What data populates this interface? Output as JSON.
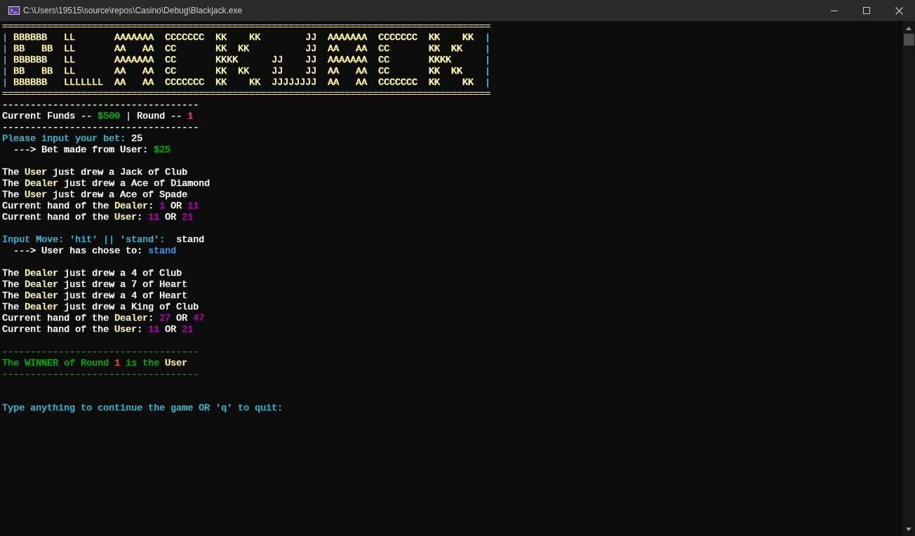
{
  "window": {
    "title": "C:\\Users\\19515\\source\\repos\\Casino\\Debug\\Blackjack.exe"
  },
  "console": {
    "banner": {
      "top_rule": {
        "text": "=======================================================================================",
        "color": "#f9f1a5"
      },
      "lines": [
        {
          "segments": [
            {
              "text": "|",
              "color": "#3ab0c8"
            },
            {
              "text": " BBBBBB   LL       AAAAAAA  CCCCCCC  KK    KK        JJ  AAAAAAA  CCCCCCC  KK    KK  ",
              "color": "#f9f1a5"
            },
            {
              "text": "|",
              "color": "#3ab0c8"
            }
          ]
        },
        {
          "segments": [
            {
              "text": "|",
              "color": "#3ab0c8"
            },
            {
              "text": " BB   BB  LL       AA   AA  CC       KK  KK          JJ  AA   AA  CC       KK  KK    ",
              "color": "#f9f1a5"
            },
            {
              "text": "|",
              "color": "#3ab0c8"
            }
          ]
        },
        {
          "segments": [
            {
              "text": "|",
              "color": "#3ab0c8"
            },
            {
              "text": " BBBBBB   LL       AAAAAAA  CC       KKKK      JJ    JJ  AAAAAAA  CC       KKKK      ",
              "color": "#f9f1a5"
            },
            {
              "text": "|",
              "color": "#3ab0c8"
            }
          ]
        },
        {
          "segments": [
            {
              "text": "|",
              "color": "#3ab0c8"
            },
            {
              "text": " BB   BB  LL       AA   AA  CC       KK  KK    JJ    JJ  AA   AA  CC       KK  KK    ",
              "color": "#f9f1a5"
            },
            {
              "text": "|",
              "color": "#3ab0c8"
            }
          ]
        },
        {
          "segments": [
            {
              "text": "|",
              "color": "#3ab0c8"
            },
            {
              "text": " BBBBBB   LLLLLLL  AA   AA  CCCCCCC  KK    KK  JJJJJJJJ  AA   AA  CCCCCCC  KK    KK  ",
              "color": "#f9f1a5"
            },
            {
              "text": "|",
              "color": "#3ab0c8"
            }
          ]
        }
      ],
      "bottom_rule": {
        "text": "=======================================================================================",
        "color": "#f9f1a5"
      }
    },
    "lines": [
      {
        "kind": "text",
        "color": "#f2f2f2",
        "segments": [
          {
            "text": "-----------------------------------"
          }
        ]
      },
      {
        "kind": "text",
        "color": "#f2f2f2",
        "segments": [
          {
            "text": "Current Funds -- "
          },
          {
            "text": "$500",
            "color": "#13a10e"
          },
          {
            "text": " | ",
            "color": "#a8c4f0"
          },
          {
            "text": "Round -- "
          },
          {
            "text": "1",
            "color": "#e74856"
          }
        ]
      },
      {
        "kind": "text",
        "color": "#f2f2f2",
        "segments": [
          {
            "text": "-----------------------------------"
          }
        ]
      },
      {
        "kind": "text",
        "color": "#f2f2f2",
        "segments": [
          {
            "text": "Please input your bet:",
            "color": "#3ab0c8"
          },
          {
            "text": " 25"
          }
        ]
      },
      {
        "kind": "text",
        "color": "#f2f2f2",
        "segments": [
          {
            "text": "  ---> Bet made from User: "
          },
          {
            "text": "$25",
            "color": "#13a10e"
          }
        ]
      },
      {
        "kind": "blank"
      },
      {
        "kind": "text",
        "color": "#f2f2f2",
        "segments": [
          {
            "text": "The "
          },
          {
            "text": "User",
            "color": "#f9f1a5"
          },
          {
            "text": " just drew a Jack of Club"
          }
        ]
      },
      {
        "kind": "text",
        "color": "#f2f2f2",
        "segments": [
          {
            "text": "The "
          },
          {
            "text": "Dealer",
            "color": "#f9f1a5"
          },
          {
            "text": " just drew a Ace of Diamond"
          }
        ]
      },
      {
        "kind": "text",
        "color": "#f2f2f2",
        "segments": [
          {
            "text": "The "
          },
          {
            "text": "User",
            "color": "#f9f1a5"
          },
          {
            "text": " just drew a Ace of Spade"
          }
        ]
      },
      {
        "kind": "text",
        "color": "#f2f2f2",
        "segments": [
          {
            "text": "Current hand of the "
          },
          {
            "text": "Dealer",
            "color": "#f9f1a5"
          },
          {
            "text": ": "
          },
          {
            "text": "1",
            "color": "#a0129e"
          },
          {
            "text": " OR "
          },
          {
            "text": "11",
            "color": "#a0129e"
          }
        ]
      },
      {
        "kind": "text",
        "color": "#f2f2f2",
        "segments": [
          {
            "text": "Current hand of the "
          },
          {
            "text": "User",
            "color": "#f9f1a5"
          },
          {
            "text": ": "
          },
          {
            "text": "11",
            "color": "#a0129e"
          },
          {
            "text": " OR "
          },
          {
            "text": "21",
            "color": "#a0129e"
          }
        ]
      },
      {
        "kind": "blank"
      },
      {
        "kind": "text",
        "color": "#f2f2f2",
        "segments": [
          {
            "text": "Input Move: 'hit' || 'stand':",
            "color": "#3ab0c8"
          },
          {
            "text": "  stand"
          }
        ]
      },
      {
        "kind": "text",
        "color": "#f2f2f2",
        "segments": [
          {
            "text": "  ---> User has chose to: "
          },
          {
            "text": "stand",
            "color": "#3a96dd"
          }
        ]
      },
      {
        "kind": "blank"
      },
      {
        "kind": "text",
        "color": "#f2f2f2",
        "segments": [
          {
            "text": "The "
          },
          {
            "text": "Dealer",
            "color": "#f9f1a5"
          },
          {
            "text": " just drew a 4 of Club"
          }
        ]
      },
      {
        "kind": "text",
        "color": "#f2f2f2",
        "segments": [
          {
            "text": "The "
          },
          {
            "text": "Dealer",
            "color": "#f9f1a5"
          },
          {
            "text": " just drew a 7 of Heart"
          }
        ]
      },
      {
        "kind": "text",
        "color": "#f2f2f2",
        "segments": [
          {
            "text": "The "
          },
          {
            "text": "Dealer",
            "color": "#f9f1a5"
          },
          {
            "text": " just drew a 4 of Heart"
          }
        ]
      },
      {
        "kind": "text",
        "color": "#f2f2f2",
        "segments": [
          {
            "text": "The "
          },
          {
            "text": "Dealer",
            "color": "#f9f1a5"
          },
          {
            "text": " just drew a King of Club"
          }
        ]
      },
      {
        "kind": "text",
        "color": "#f2f2f2",
        "segments": [
          {
            "text": "Current hand of the "
          },
          {
            "text": "Dealer",
            "color": "#f9f1a5"
          },
          {
            "text": ": "
          },
          {
            "text": "27",
            "color": "#a0129e"
          },
          {
            "text": " OR "
          },
          {
            "text": "47",
            "color": "#a0129e"
          }
        ]
      },
      {
        "kind": "text",
        "color": "#f2f2f2",
        "segments": [
          {
            "text": "Current hand of the "
          },
          {
            "text": "User",
            "color": "#f9f1a5"
          },
          {
            "text": ": "
          },
          {
            "text": "11",
            "color": "#a0129e"
          },
          {
            "text": " OR "
          },
          {
            "text": "21",
            "color": "#a0129e"
          }
        ]
      },
      {
        "kind": "blank"
      },
      {
        "kind": "text",
        "color": "#13a10e",
        "segments": [
          {
            "text": "-----------------------------------"
          }
        ]
      },
      {
        "kind": "text",
        "color": "#13a10e",
        "segments": [
          {
            "text": "The WINNER of Round "
          },
          {
            "text": "1",
            "color": "#e74856"
          },
          {
            "text": " is the "
          },
          {
            "text": "User",
            "color": "#f9f1a5"
          }
        ]
      },
      {
        "kind": "text",
        "color": "#13a10e",
        "segments": [
          {
            "text": "-----------------------------------"
          }
        ]
      },
      {
        "kind": "blank"
      },
      {
        "kind": "blank"
      },
      {
        "kind": "text",
        "color": "#3ab0c8",
        "segments": [
          {
            "text": "Type anything to continue the game OR 'q' to quit:"
          }
        ]
      }
    ]
  }
}
